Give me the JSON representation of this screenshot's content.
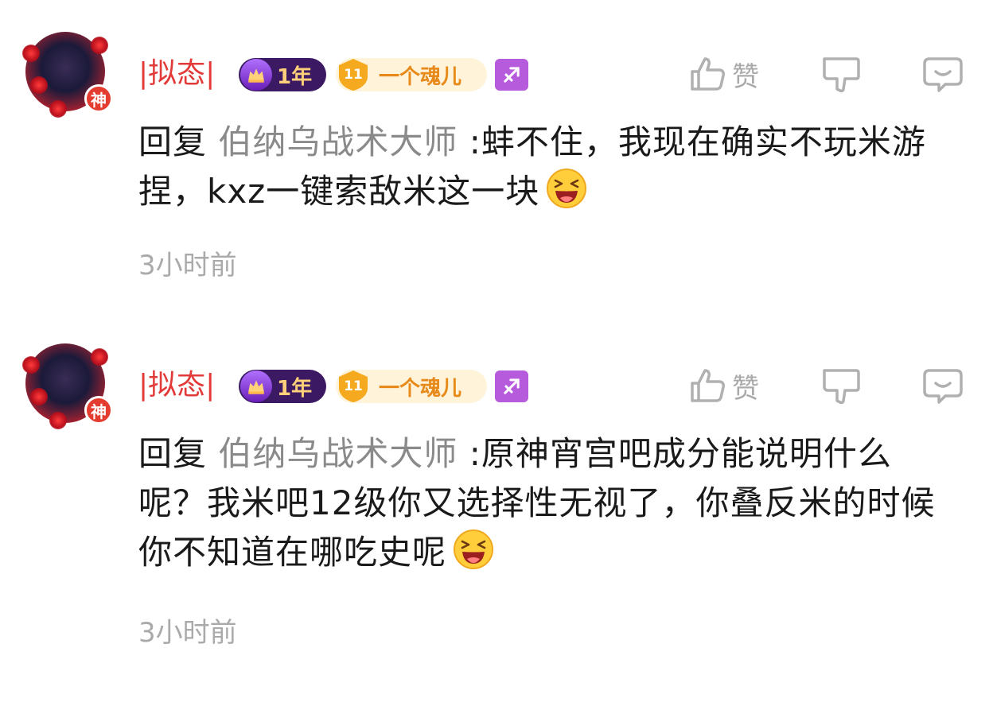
{
  "comments": [
    {
      "username": "|拟态|",
      "avatar_badge": "神",
      "year_tag": "1年",
      "level": "11",
      "level_title": "一个魂儿",
      "like_label": "赞",
      "reply_prefix": "回复",
      "reply_to": "伯纳乌战术大师",
      "text": ":蚌不住，我现在确实不玩米游捏，kxz一键索敌米这一块",
      "time": "3小时前"
    },
    {
      "username": "|拟态|",
      "avatar_badge": "神",
      "year_tag": "1年",
      "level": "11",
      "level_title": "一个魂儿",
      "like_label": "赞",
      "reply_prefix": "回复",
      "reply_to": "伯纳乌战术大师",
      "text": ":原神宵宫吧成分能说明什么呢？我米吧12级你又选择性无视了，你叠反米的时候你不知道在哪吃史呢",
      "time": "3小时前"
    }
  ],
  "colors": {
    "username": "#e23a39",
    "reply_to": "#8a8a8a",
    "muted": "#aaaaaa",
    "year_bg": "#3b1a63",
    "level_bg": "#fff3da",
    "level_text": "#e88a1a",
    "zodiac_bg": "#b65bdc"
  },
  "icons": {
    "like": "thumbs-up-icon",
    "dislike": "thumbs-down-icon",
    "reply": "chat-bubble-icon",
    "zodiac": "sagittarius-icon",
    "emoji": "laughing-emoji-icon"
  }
}
